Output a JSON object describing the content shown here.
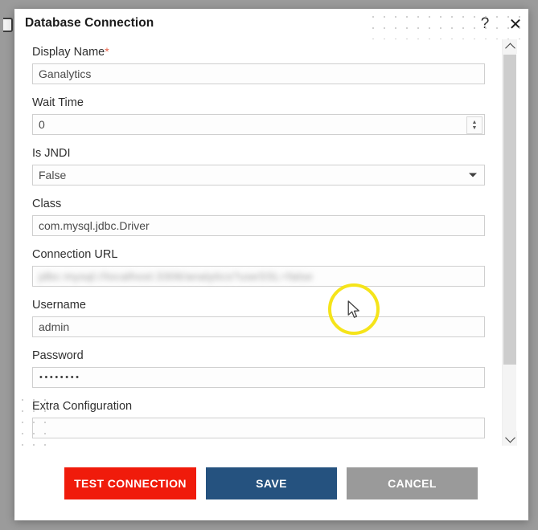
{
  "window": {
    "title": "Database Connection",
    "help_icon": "question-mark-icon",
    "close_icon": "close-icon"
  },
  "form": {
    "fields": [
      {
        "label": "Display Name",
        "required": true,
        "required_marker": "*",
        "value": "Ganalytics",
        "type": "text"
      },
      {
        "label": "Wait Time",
        "required": false,
        "value": "0",
        "type": "number"
      },
      {
        "label": "Is JNDI",
        "required": false,
        "value": "False",
        "type": "select"
      },
      {
        "label": "Class",
        "required": false,
        "value": "com.mysql.jdbc.Driver",
        "type": "text"
      },
      {
        "label": "Connection URL",
        "required": false,
        "value": "jdbc:mysql://localhost:3306/analytics?useSSL=false",
        "type": "text",
        "redacted": true
      },
      {
        "label": "Username",
        "required": false,
        "value": "admin",
        "type": "text"
      },
      {
        "label": "Password",
        "required": false,
        "value": "••••••••",
        "type": "password"
      },
      {
        "label": "Extra Configuration",
        "required": false,
        "value": "",
        "type": "text"
      }
    ]
  },
  "scrollbar": {
    "up_icon": "chevron-up-icon",
    "down_icon": "chevron-down-icon"
  },
  "footer": {
    "test_connection_label": "TEST CONNECTION",
    "save_label": "SAVE",
    "cancel_label": "CANCEL"
  },
  "colors": {
    "test_connection": "#f01b0b",
    "save": "#25527f",
    "cancel": "#9a9a9a",
    "required_star": "#e8634a",
    "highlight_ring": "#f5e41a"
  },
  "annotation": {
    "cursor_icon": "mouse-pointer-icon",
    "highlight_icon": "circle-highlight-icon"
  }
}
